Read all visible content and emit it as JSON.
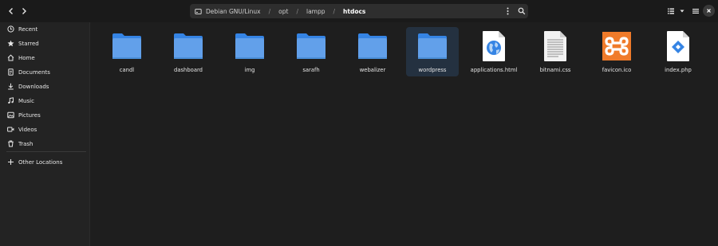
{
  "header": {
    "path": {
      "root": "Debian GNU/Linux",
      "segments": [
        "opt",
        "lampp"
      ],
      "current": "htdocs"
    }
  },
  "sidebar": {
    "items": [
      {
        "label": "Recent",
        "icon": "clock-icon"
      },
      {
        "label": "Starred",
        "icon": "star-icon"
      },
      {
        "label": "Home",
        "icon": "home-icon"
      },
      {
        "label": "Documents",
        "icon": "document-icon"
      },
      {
        "label": "Downloads",
        "icon": "download-icon"
      },
      {
        "label": "Music",
        "icon": "music-icon"
      },
      {
        "label": "Pictures",
        "icon": "picture-icon"
      },
      {
        "label": "Videos",
        "icon": "video-icon"
      },
      {
        "label": "Trash",
        "icon": "trash-icon"
      }
    ],
    "other": {
      "label": "Other Locations",
      "icon": "plus-icon"
    }
  },
  "files": [
    {
      "name": "candl",
      "type": "folder"
    },
    {
      "name": "dashboard",
      "type": "folder"
    },
    {
      "name": "img",
      "type": "folder"
    },
    {
      "name": "sarafh",
      "type": "folder"
    },
    {
      "name": "webalizer",
      "type": "folder"
    },
    {
      "name": "wordpress",
      "type": "folder",
      "selected": true
    },
    {
      "name": "applications.html",
      "type": "html"
    },
    {
      "name": "bitnami.css",
      "type": "css"
    },
    {
      "name": "favicon.ico",
      "type": "xampp-ico"
    },
    {
      "name": "index.php",
      "type": "php"
    }
  ],
  "colors": {
    "background": "#1e1e1e",
    "sidebar": "#232323",
    "folder": "#62a0ea",
    "selection": "#243140",
    "xampp": "#f07b2a"
  }
}
